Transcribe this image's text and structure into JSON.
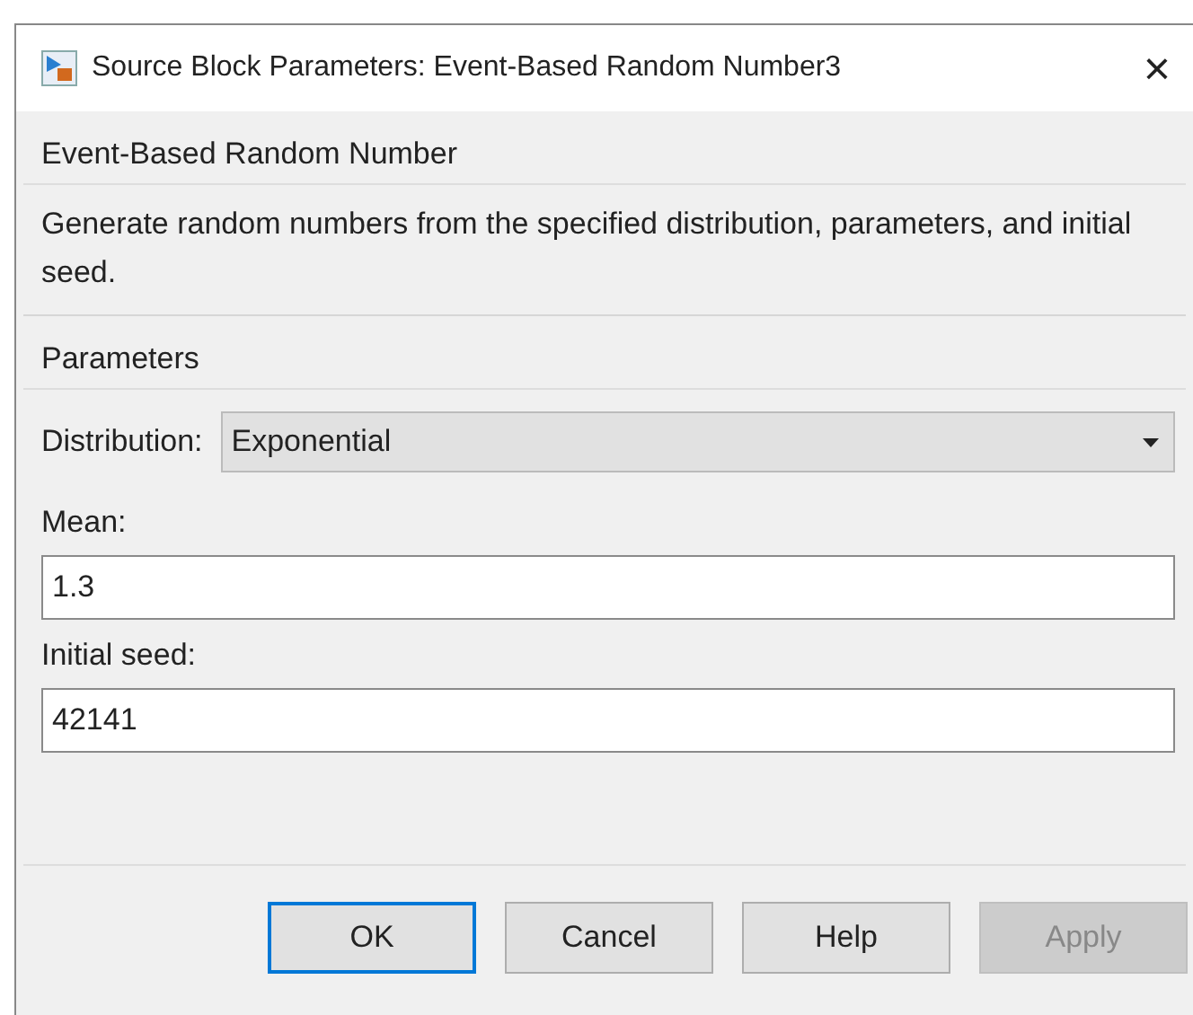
{
  "window": {
    "title": "Source Block Parameters: Event-Based Random Number3",
    "close": "×"
  },
  "block": {
    "title": "Event-Based Random Number",
    "description": "Generate random numbers from the specified distribution, parameters, and initial seed."
  },
  "parameters": {
    "title": "Parameters",
    "fields": [
      {
        "kind": "dropdown",
        "label": "Distribution:",
        "value": "Exponential"
      },
      {
        "kind": "text",
        "label": "Mean:",
        "value": "1.3"
      },
      {
        "kind": "text",
        "label": "Initial seed:",
        "value": "42141"
      }
    ]
  },
  "buttons": [
    {
      "label": "OK",
      "default": true,
      "disabled": false
    },
    {
      "label": "Cancel",
      "default": false,
      "disabled": false
    },
    {
      "label": "Help",
      "default": false,
      "disabled": false
    },
    {
      "label": "Apply",
      "default": false,
      "disabled": true
    }
  ]
}
